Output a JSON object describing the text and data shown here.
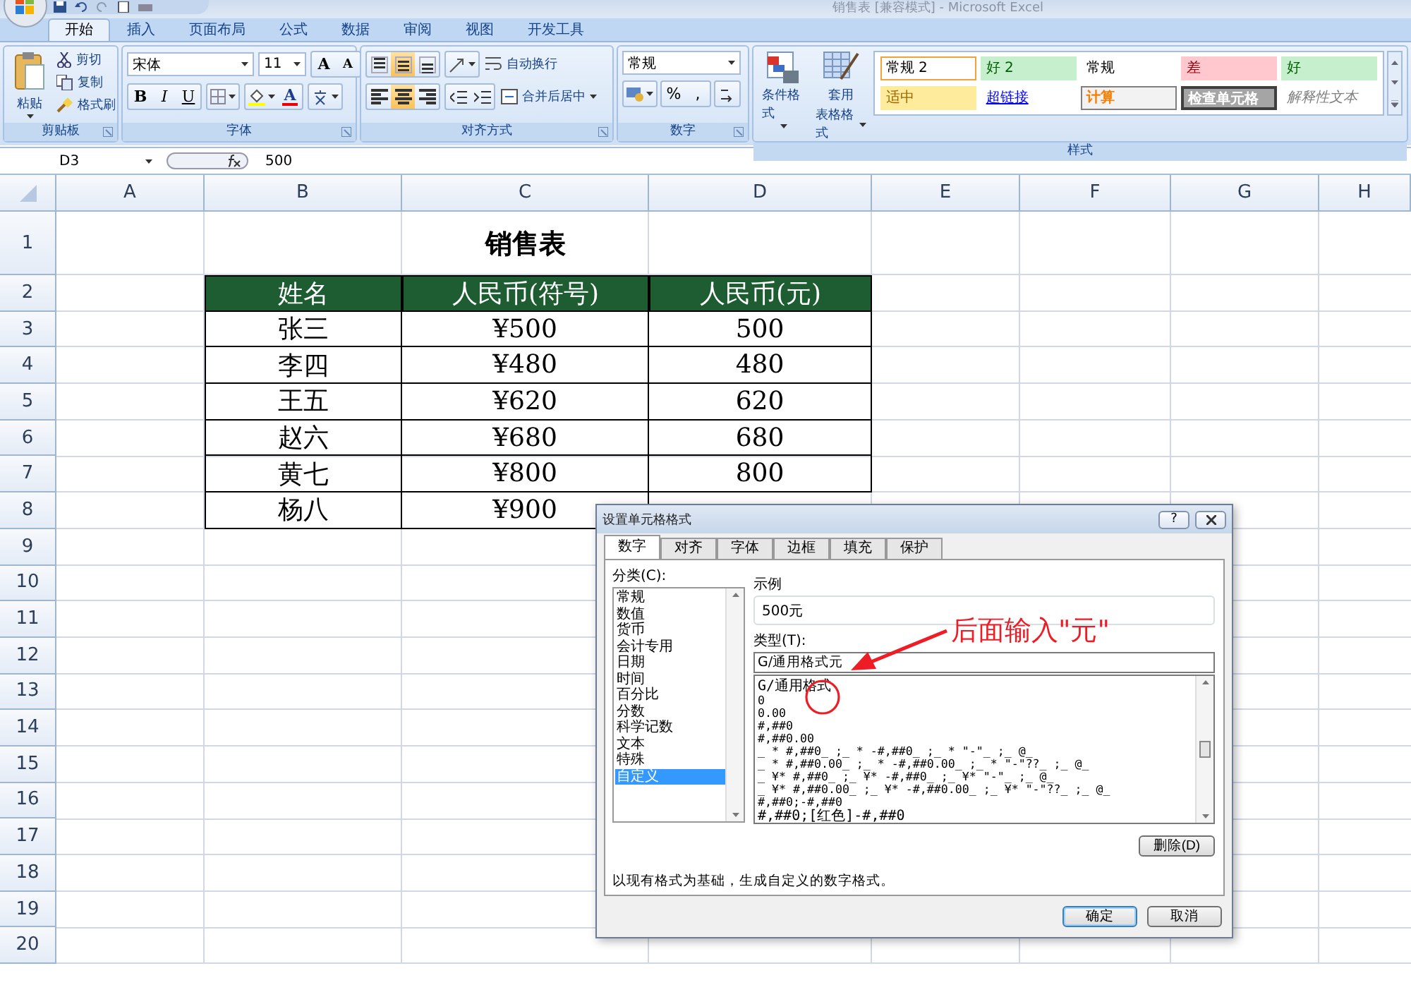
{
  "window": {
    "title": "销售表 [兼容模式] - Microsoft Excel"
  },
  "ribbon": {
    "tabs": [
      {
        "label": "开始",
        "selected": true
      },
      {
        "label": "插入",
        "selected": false
      },
      {
        "label": "页面布局",
        "selected": false
      },
      {
        "label": "公式",
        "selected": false
      },
      {
        "label": "数据",
        "selected": false
      },
      {
        "label": "审阅",
        "selected": false
      },
      {
        "label": "视图",
        "selected": false
      },
      {
        "label": "开发工具",
        "selected": false
      }
    ],
    "clipboard": {
      "paste": "粘贴",
      "cut": "剪切",
      "copy": "复制",
      "format_painter": "格式刷",
      "label": "剪贴板"
    },
    "font": {
      "font_name": "宋体",
      "font_size": "11",
      "grow": "A",
      "shrink": "A",
      "bold": "B",
      "italic": "I",
      "underline": "U",
      "font_color": "A",
      "label": "字体"
    },
    "alignment": {
      "vertical": [
        {
          "kind": "top",
          "selected": false
        },
        {
          "kind": "middle",
          "selected": true
        },
        {
          "kind": "bottom",
          "selected": false
        }
      ],
      "horizontal": [
        {
          "kind": "left",
          "selected": false
        },
        {
          "kind": "center",
          "selected": true
        },
        {
          "kind": "right",
          "selected": false
        }
      ],
      "wrap_text": "自动换行",
      "merge_center": "合并后居中",
      "label": "对齐方式"
    },
    "number": {
      "format": "常规",
      "percent": "%",
      "comma": ",",
      "label": "数字"
    },
    "styles": {
      "conditional": "条件格式",
      "table_format_1": "套用",
      "table_format_2": "表格格式",
      "label": "样式",
      "gallery": [
        {
          "kind": "normal2",
          "text": "常规 2"
        },
        {
          "kind": "good2",
          "text": "好 2"
        },
        {
          "kind": "normal",
          "text": "常规"
        },
        {
          "kind": "bad",
          "text": "差"
        },
        {
          "kind": "good",
          "text": "好"
        },
        {
          "kind": "neutral",
          "text": "适中"
        },
        {
          "kind": "link",
          "text": "超链接"
        },
        {
          "kind": "calc",
          "text": "计算"
        },
        {
          "kind": "check",
          "text": "检查单元格"
        },
        {
          "kind": "explanatory",
          "text": "解释性文本"
        }
      ]
    }
  },
  "formula_bar": {
    "name_box": "D3",
    "value": "500"
  },
  "sheet": {
    "columns": [
      "A",
      "B",
      "C",
      "D",
      "E",
      "F",
      "G",
      "H"
    ],
    "rows": [
      "1",
      "2",
      "3",
      "4",
      "5",
      "6",
      "7",
      "8",
      "9",
      "10",
      "11",
      "12",
      "13",
      "14",
      "15",
      "16",
      "17",
      "18",
      "19",
      "20"
    ],
    "table": {
      "title": "销售表",
      "header": [
        "姓名",
        "人民币(符号)",
        "人民币(元)"
      ],
      "rows": [
        [
          "张三",
          "¥500",
          "500"
        ],
        [
          "李四",
          "¥480",
          "480"
        ],
        [
          "王五",
          "¥620",
          "620"
        ],
        [
          "赵六",
          "¥680",
          "680"
        ],
        [
          "黄七",
          "¥800",
          "800"
        ],
        [
          "杨八",
          "¥900"
        ]
      ]
    }
  },
  "dialog": {
    "title": "设置单元格格式",
    "help": "?",
    "tabs": [
      {
        "label": "数字",
        "selected": true
      },
      {
        "label": "对齐",
        "selected": false
      },
      {
        "label": "字体",
        "selected": false
      },
      {
        "label": "边框",
        "selected": false
      },
      {
        "label": "填充",
        "selected": false
      },
      {
        "label": "保护",
        "selected": false
      }
    ],
    "category_label": "分类(C):",
    "categories": [
      {
        "label": "常规",
        "selected": false
      },
      {
        "label": "数值",
        "selected": false
      },
      {
        "label": "货币",
        "selected": false
      },
      {
        "label": "会计专用",
        "selected": false
      },
      {
        "label": "日期",
        "selected": false
      },
      {
        "label": "时间",
        "selected": false
      },
      {
        "label": "百分比",
        "selected": false
      },
      {
        "label": "分数",
        "selected": false
      },
      {
        "label": "科学记数",
        "selected": false
      },
      {
        "label": "文本",
        "selected": false
      },
      {
        "label": "特殊",
        "selected": false
      },
      {
        "label": "自定义",
        "selected": true
      }
    ],
    "sample_label": "示例",
    "sample": "500元",
    "type_label": "类型(T):",
    "type_value": "G/通用格式元",
    "formats": [
      "G/通用格式",
      "0",
      "0.00",
      "#,##0",
      "#,##0.00",
      "_ * #,##0_ ;_ * -#,##0_ ;_ * \"-\"_ ;_ @_",
      "_ * #,##0.00_ ;_ * -#,##0.00_ ;_ * \"-\"??_ ;_ @_",
      "_ ¥* #,##0_ ;_ ¥* -#,##0_ ;_ ¥* \"-\"_ ;_ @_",
      "_ ¥* #,##0.00_ ;_ ¥* -#,##0.00_ ;_ ¥* \"-\"??_ ;_ @_",
      "#,##0;-#,##0",
      "#,##0;[红色]-#,##0"
    ],
    "delete": "删除(D)",
    "description": "以现有格式为基础，生成自定义的数字格式。",
    "ok": "确定",
    "cancel": "取消",
    "annotation": "后面输入\"元\""
  }
}
